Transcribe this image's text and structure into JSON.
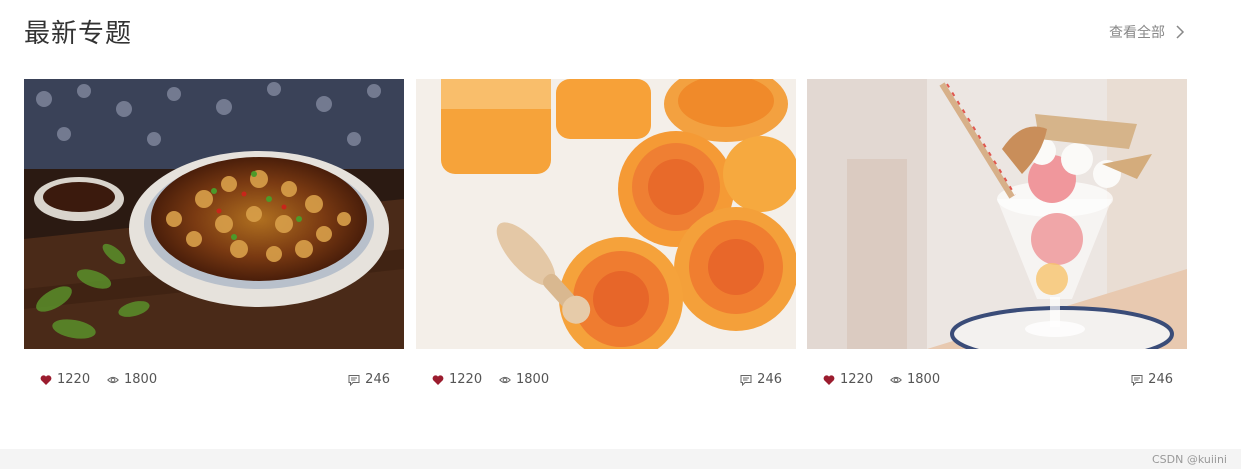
{
  "section": {
    "title": "最新专题",
    "view_all_label": "查看全部"
  },
  "cards": [
    {
      "image": "spicy-snails-dish-image",
      "likes": "1220",
      "views": "1800",
      "comments": "246"
    },
    {
      "image": "orange-juice-squeezer-image",
      "likes": "1220",
      "views": "1800",
      "comments": "246"
    },
    {
      "image": "ice-cream-sundae-image",
      "likes": "1220",
      "views": "1800",
      "comments": "246"
    }
  ],
  "icons": {
    "like": "heart-icon",
    "view": "eye-icon",
    "comment": "comment-icon",
    "more": "chevron-right-icon"
  },
  "colors": {
    "like_heart": "#9b1c2e",
    "muted_text": "#888888",
    "footer_bg": "#f4f4f4"
  },
  "watermark": "CSDN @kuiini"
}
